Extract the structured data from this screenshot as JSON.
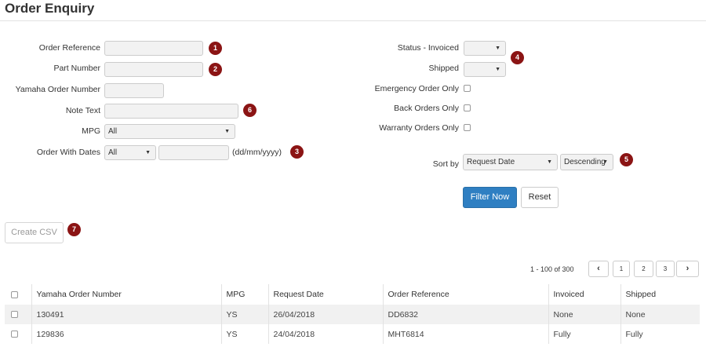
{
  "page": {
    "title": "Order Enquiry"
  },
  "filters_left": {
    "order_reference": {
      "label": "Order Reference",
      "value": "",
      "badge": "1"
    },
    "part_number": {
      "label": "Part Number",
      "value": "",
      "badge": "2"
    },
    "yamaha_order_number": {
      "label": "Yamaha Order Number",
      "value": ""
    },
    "note_text": {
      "label": "Note Text",
      "value": "",
      "badge": "6"
    },
    "mpg": {
      "label": "MPG",
      "selected": "All"
    },
    "order_with_dates": {
      "label": "Order With Dates",
      "selected": "All",
      "date_value": "",
      "hint": "(dd/mm/yyyy)",
      "badge": "3"
    }
  },
  "filters_right": {
    "status_invoiced": {
      "label": "Status - Invoiced",
      "selected": "",
      "badge": "4"
    },
    "shipped": {
      "label": "Shipped",
      "selected": ""
    },
    "emergency_only": {
      "label": "Emergency Order Only",
      "checked": false
    },
    "back_orders_only": {
      "label": "Back Orders Only",
      "checked": false
    },
    "warranty_only": {
      "label": "Warranty Orders Only",
      "checked": false
    },
    "sort_by": {
      "label": "Sort by",
      "field": "Request Date",
      "direction": "Descending",
      "badge": "5"
    }
  },
  "actions": {
    "filter_now": "Filter Now",
    "reset": "Reset",
    "create_csv": "Create CSV",
    "csv_badge": "7"
  },
  "pagination": {
    "info": "1 - 100 of 300",
    "prev": "‹",
    "next": "›",
    "pages": [
      "1",
      "2",
      "3"
    ]
  },
  "table": {
    "columns": [
      "Yamaha Order Number",
      "MPG",
      "Request Date",
      "Order Reference",
      "Invoiced",
      "Shipped"
    ],
    "rows": [
      [
        "130491",
        "YS",
        "26/04/2018",
        "DD6832",
        "None",
        "None"
      ],
      [
        "129836",
        "YS",
        "24/04/2018",
        "MHT6814",
        "Fully",
        "Fully"
      ]
    ]
  }
}
